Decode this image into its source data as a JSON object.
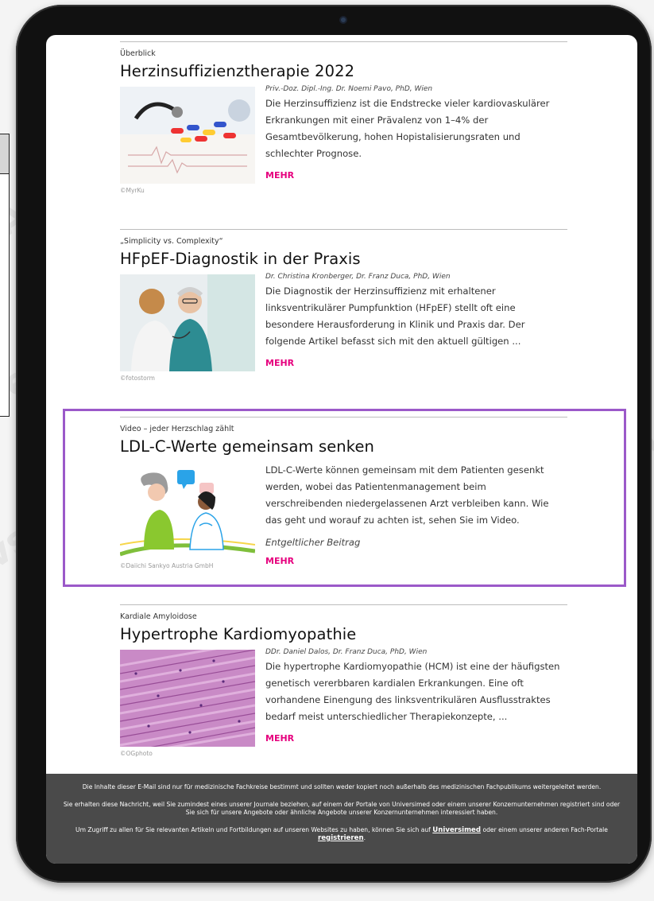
{
  "articles": [
    {
      "kicker": "Überblick",
      "title": "Herzinsuffizienztherapie 2022",
      "author": "Priv.-Doz. Dipl.-Ing. Dr. Noemi Pavo, PhD, Wien",
      "teaser": "Die Herzinsuffizienz ist die Endstrecke vieler kardiovaskulärer Erkrankungen mit einer Prävalenz von 1–4% der Gesamtbevölkerung, hohen Hopistalisierungsraten und schlechter Prognose.",
      "more": "MEHR",
      "credit": "©MyrKu"
    },
    {
      "kicker": "„Simplicity vs. Complexity“",
      "title": "HFpEF-Diagnostik in der Praxis",
      "author": "Dr. Christina Kronberger, Dr. Franz Duca, PhD, Wien",
      "teaser": "Die Diagnostik der Herzinsuffizienz mit erhaltener linksventrikulärer Pumpfunktion (HFpEF) stellt oft eine besondere Herausforderung in Klinik und Praxis dar. Der folgende Artikel befasst sich mit den aktuell gültigen ...",
      "more": "MEHR",
      "credit": "©fotostorm"
    },
    {
      "kicker": "Video – jeder Herzschlag zählt",
      "title": "LDL-C-Werte gemeinsam senken",
      "teaser": "LDL-C-Werte können gemeinsam mit dem Patienten gesenkt werden, wobei das Patientenmanagement beim verschreibenden niedergelassenen Arzt verbleiben kann. Wie das geht und worauf zu achten ist, sehen Sie im Video.",
      "sponsor": "Entgeltlicher Beitrag",
      "more": "MEHR",
      "credit": "©Daiichi Sankyo Austria GmbH"
    },
    {
      "kicker": "Kardiale Amyloidose",
      "title": "Hypertrophe Kardiomyopathie",
      "author": "DDr. Daniel Dalos, Dr. Franz Duca, PhD, Wien",
      "teaser": "Die hypertrophe Kardiomyopathie (HCM) ist eine der häufigsten genetisch vererbbaren kardialen Erkrankungen. Eine oft vorhandene Einengung des linksventrikulären Ausflusstraktes bedarf meist unterschiedlicher Therapiekonzepte, ...",
      "more": "MEHR",
      "credit": "©OGphoto"
    }
  ],
  "footer": {
    "line1": "Die Inhalte dieser E-Mail sind nur für medizinische Fachkreise bestimmt und sollten weder kopiert noch außerhalb des medizinischen Fachpublikums weitergeleitet werden.",
    "line2": "Sie erhalten diese Nachricht, weil Sie zumindest eines unserer Journale beziehen, auf einem der Portale von Universimed oder einem unserer Konzernunternehmen registriert sind oder Sie sich für unsere Angebote oder ähnliche Angebote unserer Konzernunternehmen interessiert haben.",
    "line3_pre": "Um Zugriff zu allen für Sie relevanten Artikeln und Fortbildungen auf unseren Websites zu haben, können Sie sich auf",
    "link1": "Universimed",
    "line3_mid": "oder einem unserer anderen Fach-Portale",
    "link2": "registrieren",
    "line3_post": "."
  },
  "colors": {
    "accent": "#e6007e",
    "highlight": "#9b59c9",
    "footer_bg": "#4a4a4a"
  }
}
